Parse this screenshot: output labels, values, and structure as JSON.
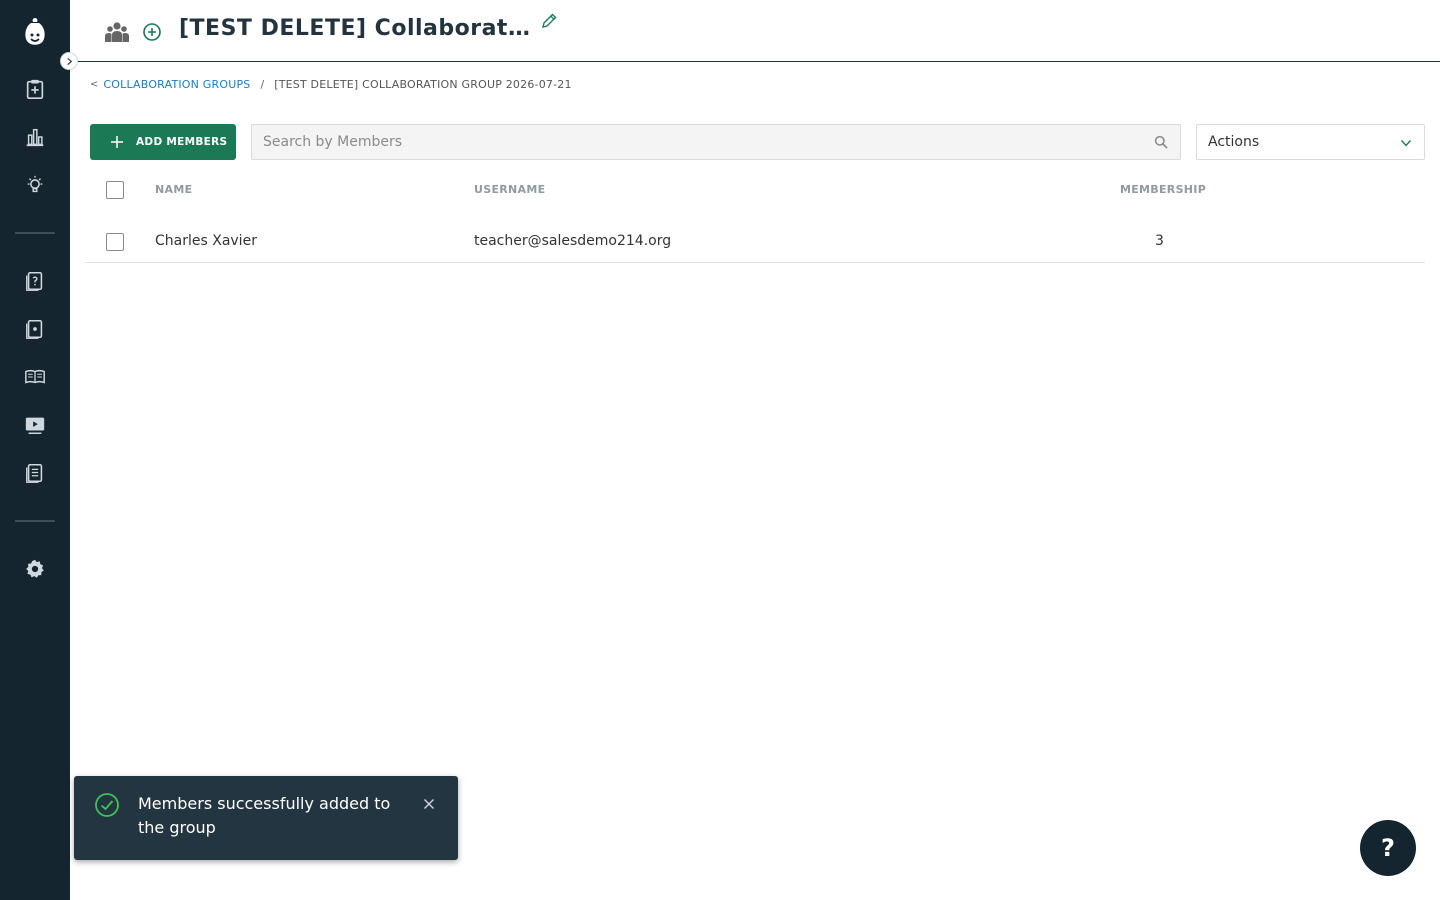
{
  "app": {
    "title": "[TEST DELETE] Collaboration..."
  },
  "sidebar": {
    "items": [
      {
        "icon": "logo-icon"
      },
      {
        "icon": "clipboard-plus-icon"
      },
      {
        "icon": "bar-chart-icon"
      },
      {
        "icon": "lightbulb-icon"
      },
      {
        "icon": "question-doc-icon"
      },
      {
        "icon": "doc-dot-icon"
      },
      {
        "icon": "open-book-icon"
      },
      {
        "icon": "video-icon"
      },
      {
        "icon": "doc-list-icon"
      },
      {
        "icon": "gear-icon"
      }
    ]
  },
  "breadcrumb": {
    "back": "<",
    "link": "COLLABORATION GROUPS",
    "separator": "/",
    "current": "[TEST DELETE] COLLABORATION GROUP 2026-07-21"
  },
  "toolbar": {
    "add_label": "ADD MEMBERS",
    "search_placeholder": "Search by Members",
    "actions_label": "Actions"
  },
  "table": {
    "columns": [
      "NAME",
      "USERNAME",
      "MEMBERSHIP"
    ],
    "rows": [
      {
        "name": "Charles Xavier",
        "username": "teacher@salesdemo214.org",
        "membership": "3"
      }
    ]
  },
  "toast": {
    "message": "Members successfully added to the group",
    "close": "×"
  },
  "help": {
    "label": "?"
  },
  "colors": {
    "sidebar": "#142530",
    "primary": "#1b7a55",
    "link": "#1b7bc4",
    "toast": "#243542",
    "success": "#3cc45b"
  }
}
